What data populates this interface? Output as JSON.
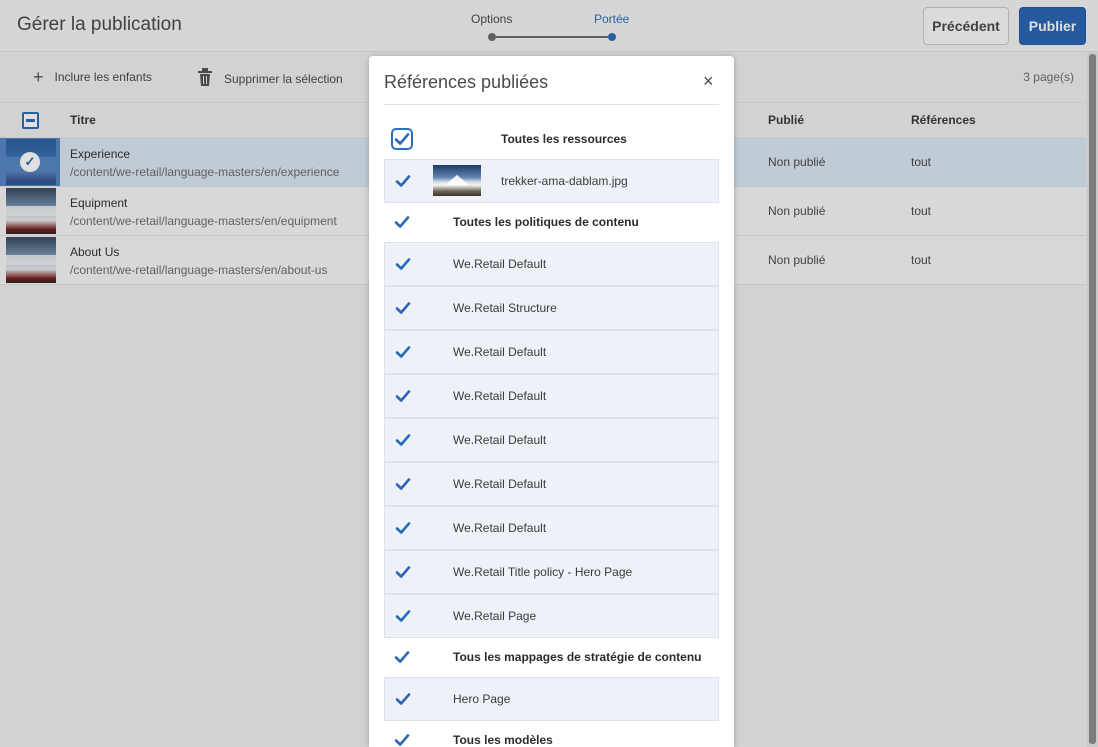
{
  "header": {
    "title": "Gérer la publication",
    "wizard": {
      "step1": "Options",
      "step2": "Portée"
    },
    "prev_label": "Précédent",
    "publish_label": "Publier"
  },
  "toolbar": {
    "include_children": "Inclure les enfants",
    "delete_selection": "Supprimer la sélection",
    "page_count": "3 page(s)"
  },
  "table": {
    "columns": {
      "title": "Titre",
      "published": "Publié",
      "references": "Références"
    },
    "rows": [
      {
        "name": "Experience",
        "path": "/content/we-retail/language-masters/en/experience",
        "status": "Non publié",
        "refs": "tout"
      },
      {
        "name": "Equipment",
        "path": "/content/we-retail/language-masters/en/equipment",
        "status": "Non publié",
        "refs": "tout"
      },
      {
        "name": "About Us",
        "path": "/content/we-retail/language-masters/en/about-us",
        "status": "Non publié",
        "refs": "tout"
      }
    ]
  },
  "dialog": {
    "title": "Références publiées",
    "close": "×",
    "groups": {
      "assets": "Toutes les ressources",
      "asset_item": "trekker-ama-dablam.jpg",
      "policies": "Toutes les politiques de contenu",
      "policy_items": [
        "We.Retail Default",
        "We.Retail Structure",
        "We.Retail Default",
        "We.Retail Default",
        "We.Retail Default",
        "We.Retail Default",
        "We.Retail Default",
        "We.Retail Title policy - Hero Page",
        "We.Retail Page"
      ],
      "mappings": "Tous les mappages de stratégie de contenu",
      "mapping_item": "Hero Page",
      "templates": "Tous les modèles"
    }
  },
  "colors": {
    "accent": "#2b67b6",
    "selected_row": "#dce7f3",
    "item_bg": "#eef2f8"
  },
  "icons": [
    "plus-icon",
    "trash-icon",
    "check-icon",
    "close-icon"
  ]
}
